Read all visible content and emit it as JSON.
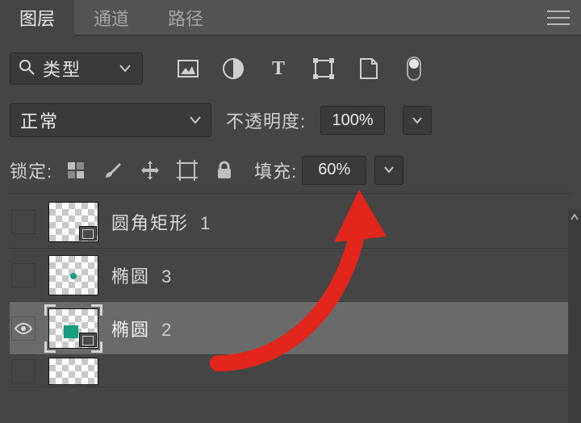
{
  "tabs": {
    "layers": "图层",
    "channels": "通道",
    "paths": "路径",
    "active": "layers"
  },
  "filter": {
    "label": "类型",
    "icons": [
      "image-filter-icon",
      "adjustment-filter-icon",
      "type-filter-icon",
      "shape-filter-icon",
      "smartobject-filter-icon",
      "toggle-filter-icon"
    ]
  },
  "blend": {
    "mode": "正常"
  },
  "opacity": {
    "label": "不透明度:",
    "value": "100%"
  },
  "lock": {
    "label": "锁定:"
  },
  "fill": {
    "label": "填充:",
    "value": "60%"
  },
  "layers": [
    {
      "name": "圆角矩形",
      "num": "1",
      "visible": false,
      "selected": false,
      "vectorBadge": true
    },
    {
      "name": "椭圆",
      "num": "3",
      "visible": false,
      "selected": false,
      "dot": true
    },
    {
      "name": "椭圆",
      "num": "2",
      "visible": true,
      "selected": true,
      "vectorBadge": true,
      "blob": true
    }
  ],
  "annotation_color": "#e3261b"
}
